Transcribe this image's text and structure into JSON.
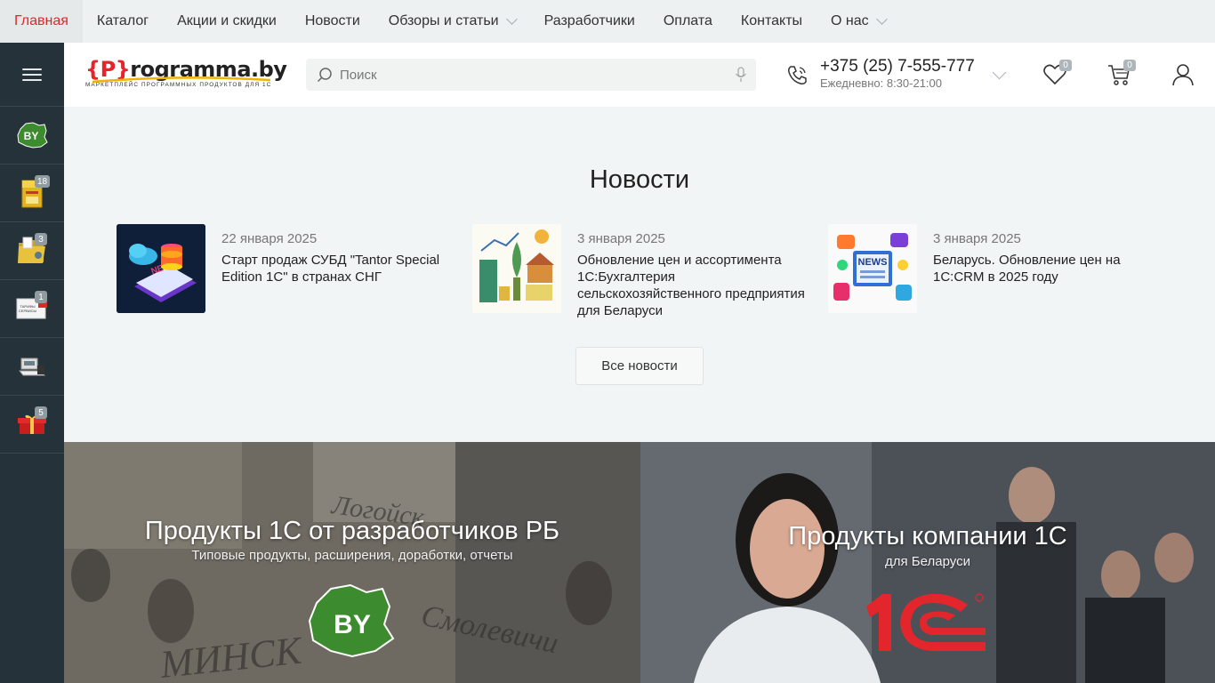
{
  "topnav": {
    "items": [
      {
        "label": "Главная",
        "active": true
      },
      {
        "label": "Каталог"
      },
      {
        "label": "Акции и скидки"
      },
      {
        "label": "Новости"
      },
      {
        "label": "Обзоры и статьи",
        "dropdown": true
      },
      {
        "label": "Разработчики"
      },
      {
        "label": "Оплата"
      },
      {
        "label": "Контакты"
      },
      {
        "label": "О нас",
        "dropdown": true
      }
    ]
  },
  "sidebar": {
    "menu_icon": "hamburger-icon",
    "items": [
      {
        "icon": "belarus-map-icon",
        "label": "BY"
      },
      {
        "icon": "product-box-icon",
        "badge": "18"
      },
      {
        "icon": "folder-icon",
        "badge": "3"
      },
      {
        "icon": "tariffs-card-icon",
        "badge": "1",
        "label": "ТАРИФЫ СЕРВИСЫ"
      },
      {
        "icon": "hardware-devices-icon"
      },
      {
        "icon": "gift-icon",
        "badge": "5"
      }
    ]
  },
  "header": {
    "logo_text_bracket": "{P}",
    "logo_text_rest": "rogramma.by",
    "logo_sub": "МАРКЕТПЛЕЙС ПРОГРАММНЫХ ПРОДУКТОВ ДЛЯ 1С",
    "search_placeholder": "Поиск",
    "phone": "+375 (25) 7-555-777",
    "hours": "Ежедневно: 8:30-21:00",
    "wishlist_count": "0",
    "cart_count": "0"
  },
  "news": {
    "heading": "Новости",
    "items": [
      {
        "date": "22 января 2025",
        "title": "Старт продаж СУБД \"Tantor Special Edition 1С\" в странах СНГ",
        "thumb_text": "NEWS"
      },
      {
        "date": "3 января 2025",
        "title": "Обновление цен и ассортимента 1С:Бухгалтерия сельскохозяйственного предприятия для Беларуси"
      },
      {
        "date": "3 января 2025",
        "title": "Беларусь. Обновление цен на 1С:CRM в 2025 году",
        "thumb_text": "NEWS"
      }
    ],
    "all_button": "Все новости"
  },
  "banners": [
    {
      "title": "Продукты 1С от разработчиков РБ",
      "subtitle": "Типовые продукты, расширения, доработки, отчеты",
      "badge": "BY",
      "bg_words": [
        "Логойск",
        "Смолевичи",
        "МИНСК"
      ]
    },
    {
      "title": "Продукты компании 1С",
      "subtitle": "для Беларуси",
      "logo": "1С"
    }
  ],
  "colors": {
    "accent": "#e3262c",
    "sidebar_bg": "#26323a",
    "page_bg": "#f2f5f5",
    "by_green": "#3c8b2e"
  }
}
